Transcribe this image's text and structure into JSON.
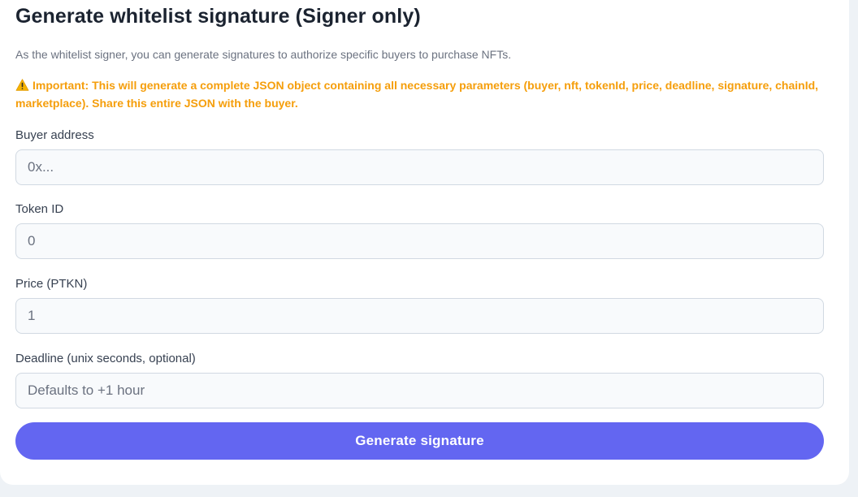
{
  "header": {
    "title": "Generate whitelist signature (Signer only)",
    "description": "As the whitelist signer, you can generate signatures to authorize specific buyers to purchase NFTs."
  },
  "notice": {
    "icon": "warning-icon",
    "color": "#f59e0b",
    "text": "Important: This will generate a complete JSON object containing all necessary parameters (buyer, nft, tokenId, price, deadline, signature, chainId, marketplace). Share this entire JSON with the buyer."
  },
  "form": {
    "fields": [
      {
        "label": "Buyer address",
        "value": "",
        "placeholder": "0x..."
      },
      {
        "label": "Token ID",
        "value": "",
        "placeholder": "0"
      },
      {
        "label": "Price (PTKN)",
        "value": "",
        "placeholder": "1"
      },
      {
        "label": "Deadline (unix seconds, optional)",
        "value": "",
        "placeholder": "Defaults to +1 hour"
      }
    ],
    "submit_label": "Generate signature",
    "accent": "#6366f1"
  }
}
